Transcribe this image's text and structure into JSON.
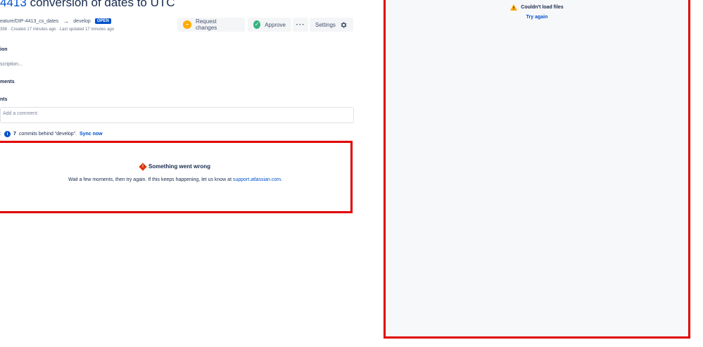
{
  "header": {
    "title_link": "4413",
    "title_text": "conversion of dates to UTC",
    "source_branch": "eature/DIP-4413_cs_dates",
    "destination_branch": "develop",
    "status_badge": "OPEN",
    "meta": "398 · Created 17 minutes ago · Last updated 17 minutes ago"
  },
  "toolbar": {
    "request_changes_label": "Request changes",
    "approve_label": "Approve",
    "more_label": "···",
    "settings_label": "Settings"
  },
  "sections": {
    "description_heading": "ion",
    "description_placeholder": "scription...",
    "attachments_heading": "ments",
    "comments_heading": "nts"
  },
  "comment": {
    "placeholder": "Add a comment"
  },
  "sync_notice": {
    "prefix": ":",
    "count": "7",
    "text": "commits behind “develop”.",
    "link_label": "Sync now"
  },
  "error_panel": {
    "title": "Something went wrong",
    "message": "Wait a few moments, then try again. If this keeps happening, let us know at",
    "link_label": "support.atlassian.com",
    "suffix": "."
  },
  "files_panel": {
    "error_title": "Couldn't load files",
    "retry_label": "Try again"
  },
  "colors": {
    "link_blue": "#0052cc",
    "text_dark": "#172b4d",
    "highlight_red": "#e00000",
    "approve_green": "#36b37e",
    "request_yellow": "#ffab00",
    "error_red": "#de350b",
    "warning_amber": "#ffab00"
  },
  "icons": {
    "request_changes": "request-changes-icon",
    "approve": "check-circle-icon",
    "settings": "gear-icon",
    "branch_arrow": "arrow-right-icon",
    "sync_info": "info-icon",
    "error": "error-icon",
    "files_warning": "warning-icon"
  }
}
